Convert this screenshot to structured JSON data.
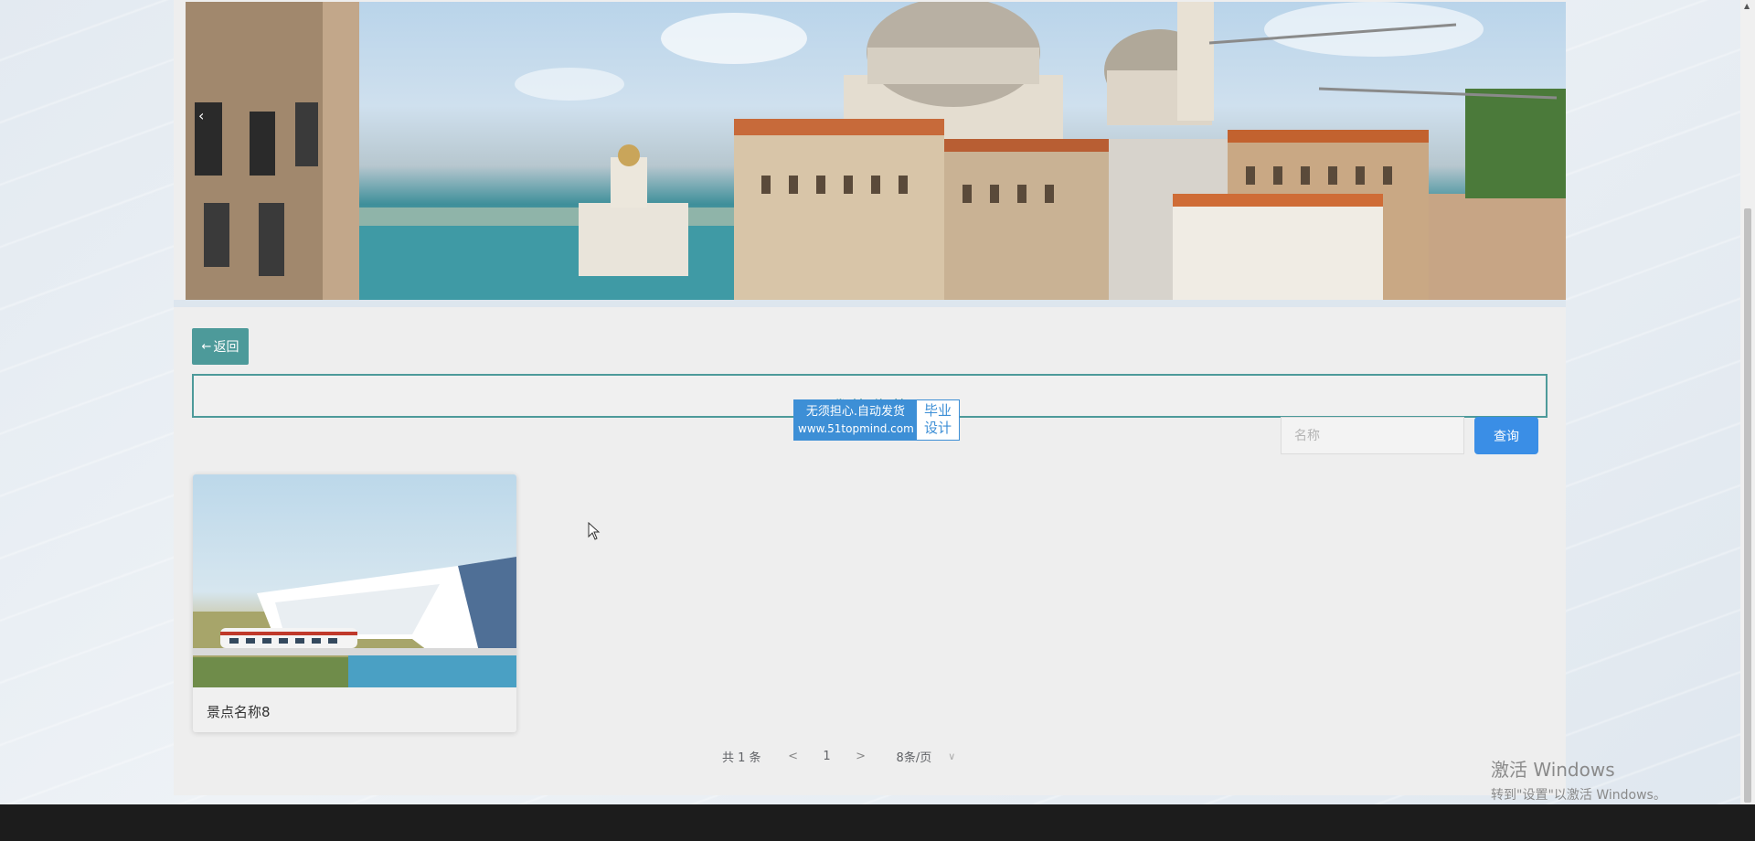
{
  "back_button": {
    "icon": "arrow-left-icon",
    "label": "返回"
  },
  "page_title": "我的收藏",
  "watermark": {
    "line1": "无须担心.自动发货",
    "line2": "www.51topmind.com",
    "right_line1": "毕业",
    "right_line2": "设计"
  },
  "search": {
    "placeholder": "名称",
    "button_label": "查询"
  },
  "cards": [
    {
      "title": "景点名称8"
    }
  ],
  "pagination": {
    "total_text": "共 1 条",
    "prev": "<",
    "current_page": "1",
    "next": ">",
    "page_size": "8条/页"
  },
  "windows_activation": {
    "line1": "激活 Windows",
    "line2": "转到\"设置\"以激活 Windows。"
  },
  "banner": {
    "prev_arrow": "‹"
  },
  "colors": {
    "accent": "#4d9a9a",
    "primary_button": "#3a8ee6",
    "watermark_blue": "#3d8fd6"
  }
}
